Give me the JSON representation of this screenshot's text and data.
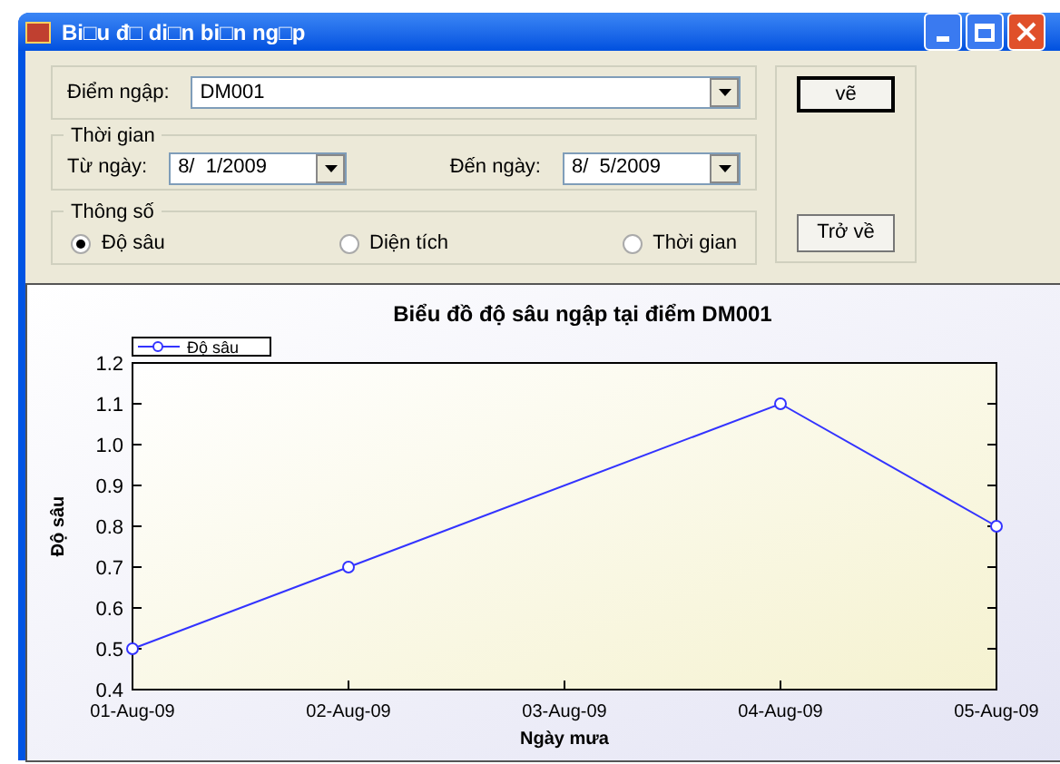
{
  "window": {
    "title": "Bi□u đ□ di□n bi□n ng□p"
  },
  "point_field": {
    "label": "Điểm ngập:",
    "value": "DM001"
  },
  "time_group": {
    "title": "Thời gian",
    "from_label": "Từ ngày:",
    "from_value": "8/  1/2009",
    "to_label": "Đến ngày:",
    "to_value": "8/  5/2009"
  },
  "parameter_group": {
    "title": "Thông số",
    "options": [
      {
        "label": "Độ sâu",
        "selected": true
      },
      {
        "label": "Diện tích",
        "selected": false
      },
      {
        "label": "Thời gian",
        "selected": false
      }
    ]
  },
  "buttons": {
    "draw": "vẽ",
    "back": "Trở về"
  },
  "chart": {
    "chart_data": {
      "type": "line",
      "title": "Biểu đồ độ sâu ngập tại điểm DM001",
      "xlabel": "Ngày mưa",
      "ylabel": "Độ sâu",
      "categories": [
        "01-Aug-09",
        "02-Aug-09",
        "03-Aug-09",
        "04-Aug-09",
        "05-Aug-09"
      ],
      "series": [
        {
          "name": "Độ sâu",
          "color": "#3333ff",
          "marker": "circle",
          "values": [
            0.5,
            0.7,
            null,
            1.1,
            0.8
          ]
        }
      ],
      "ylim": [
        0.4,
        1.2
      ],
      "yticks": [
        {
          "value": 0.4,
          "label": "0.4"
        },
        {
          "value": 0.5,
          "label": "0.5"
        },
        {
          "value": 0.6,
          "label": "0.6"
        },
        {
          "value": 0.7,
          "label": "0.7"
        },
        {
          "value": 0.8,
          "label": "0.8"
        },
        {
          "value": 0.9,
          "label": "0.9"
        },
        {
          "value": 1.0,
          "label": "1.0"
        },
        {
          "value": 1.1,
          "label": "1.1"
        },
        {
          "value": 1.2,
          "label": "1.2"
        }
      ]
    }
  }
}
